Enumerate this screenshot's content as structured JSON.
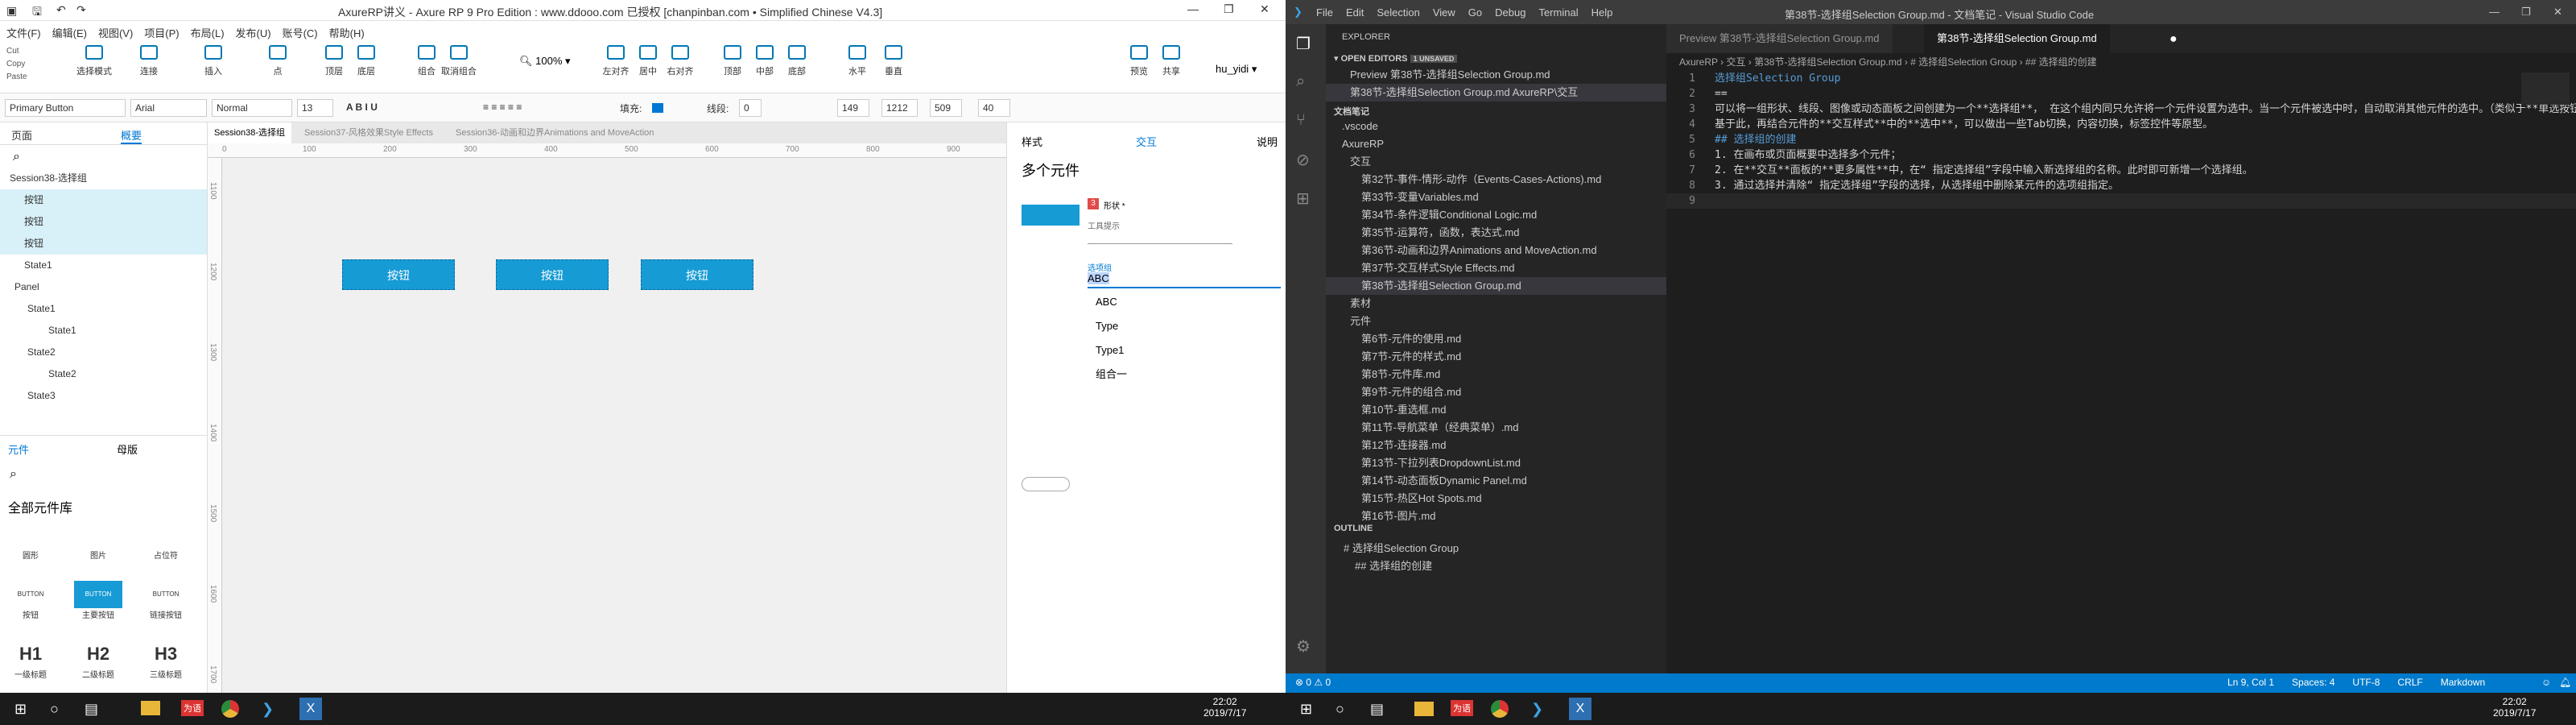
{
  "axure": {
    "title": "AxureRP讲义 - Axure RP 9 Pro Edition : www.ddooo.com 已授权  [chanpinban.com • Simplified Chinese V4.3]",
    "menu": [
      "文件(F)",
      "编辑(E)",
      "视图(V)",
      "项目(P)",
      "布局(L)",
      "发布(U)",
      "账号(C)",
      "帮助(H)"
    ],
    "clip": [
      "Cut",
      "Copy",
      "Paste"
    ],
    "tools": [
      "选择模式",
      "连接",
      "插入",
      "点",
      "顶层",
      "底层",
      "组合",
      "取消组合",
      "左对齐",
      "居中",
      "右对齐",
      "顶部",
      "中部",
      "底部",
      "水平",
      "垂直",
      "预览",
      "共享"
    ],
    "zoom": "100%",
    "user": "hu_yidi",
    "fmt": {
      "style": "Primary Button",
      "font": "Arial",
      "weight": "Normal",
      "size": "13",
      "fill": "填充:",
      "line": "线段:",
      "line_w": "0",
      "x": "149",
      "y": "1212",
      "w": "509",
      "h": "40"
    },
    "left_tabs": [
      "页面",
      "概要"
    ],
    "outline": [
      "Session38-选择组",
      "按钮",
      "按钮",
      "按钮",
      "State1",
      "Panel",
      "State1",
      "State1",
      "State2",
      "State2",
      "State3"
    ],
    "lib_tabs": [
      "元件",
      "母版"
    ],
    "lib_title": "全部元件库",
    "lib_items": [
      "圆形",
      "图片",
      "占位符",
      "按钮",
      "主要按钮",
      "链接按钮",
      "一级标题",
      "二级标题",
      "三级标题"
    ],
    "lib_glyph": [
      "",
      "",
      "",
      "BUTTON",
      "BUTTON",
      "BUTTON",
      "H1",
      "H2",
      "H3"
    ],
    "doc_tabs": [
      "Session38-选择组",
      "Session37-风格效果Style Effects",
      "Session36-动画和边界Animations and MoveAction"
    ],
    "ruler_h": [
      "0",
      "100",
      "200",
      "300",
      "400",
      "500",
      "600",
      "700",
      "800",
      "900"
    ],
    "ruler_v": [
      "1100",
      "1200",
      "1300",
      "1400",
      "1500",
      "1600",
      "1700"
    ],
    "canvas_buttons": [
      "按钮",
      "按钮",
      "按钮"
    ],
    "right_tabs": [
      "样式",
      "交互",
      "说明"
    ],
    "right_title": "多个元件",
    "badge": "3",
    "form_label": "形状 *",
    "tooltip_label": "工具提示",
    "select_label": "选项组",
    "select_value": "ABC",
    "options": [
      "ABC",
      "Type",
      "Type1",
      "组合一"
    ]
  },
  "vscode": {
    "menu": [
      "File",
      "Edit",
      "Selection",
      "View",
      "Go",
      "Debug",
      "Terminal",
      "Help"
    ],
    "title": "第38节-选择组Selection Group.md - 文档笔记 - Visual Studio Code",
    "explorer": "EXPLORER",
    "open_editors": "OPEN EDITORS",
    "unsaved": "1 UNSAVED",
    "open_files": [
      "Preview 第38节-选择组Selection Group.md",
      "第38节-选择组Selection Group.md  AxureRP\\交互"
    ],
    "folder": "文档笔记",
    "tree": [
      ".vscode",
      "AxureRP",
      "交互",
      "第32节-事件-情形-动作（Events-Cases-Actions).md",
      "第33节-变量Variables.md",
      "第34节-条件逻辑Conditional Logic.md",
      "第35节-运算符，函数，表达式.md",
      "第36节-动画和边界Animations and MoveAction.md",
      "第37节-交互样式Style Effects.md",
      "第38节-选择组Selection Group.md",
      "素材",
      "元件",
      "第6节-元件的使用.md",
      "第7节-元件的样式.md",
      "第8节-元件库.md",
      "第9节-元件的组合.md",
      "第10节-重选框.md",
      "第11节-导航菜单（经典菜单）.md",
      "第12节-连接器.md",
      "第13节-下拉列表DropdownList.md",
      "第14节-动态面板Dynamic Panel.md",
      "第15节-热区Hot Spots.md",
      "第16节-图片.md"
    ],
    "outline": "OUTLINE",
    "outline_items": [
      "# 选择组Selection Group",
      "## 选择组的创建"
    ],
    "tabs": [
      "Preview 第38节-选择组Selection Group.md",
      "第38节-选择组Selection Group.md"
    ],
    "breadcrumb": "AxureRP › 交互 › 第38节-选择组Selection Group.md › # 选择组Selection Group › ## 选择组的创建",
    "lines": [
      "选择组Selection Group",
      "==",
      "可以将一组形状、线段、图像或动态面板之间创建为一个**选择组**，  在这个组内同只允许将一个元件设置为选中。当一个元件被选中时，自动取消其他元件的选中。（类似于**单选按钮**之间的关系）",
      "基于此，再结合元件的**交互样式**中的**选中**，可以做出一些Tab切换，内容切换，标签控件等原型。",
      "## 选择组的创建",
      "1. 在画布或页面概要中选择多个元件；",
      "2. 在**交互**面板的**更多属性**中，在“ 指定选择组”字段中输入新选择组的名称。此时即可新增一个选择组。",
      "3. 通过选择并清除“ 指定选择组”字段的选择，从选择组中删除某元件的选项组指定。",
      ""
    ],
    "status_left": "⊗ 0  ⚠ 0",
    "status_right": [
      "Ln 9, Col 1",
      "Spaces: 4",
      "UTF-8",
      "CRLF",
      "Markdown"
    ]
  },
  "taskbar": {
    "time": "22:02",
    "date": "2019/7/17",
    "app_red": "为语"
  }
}
